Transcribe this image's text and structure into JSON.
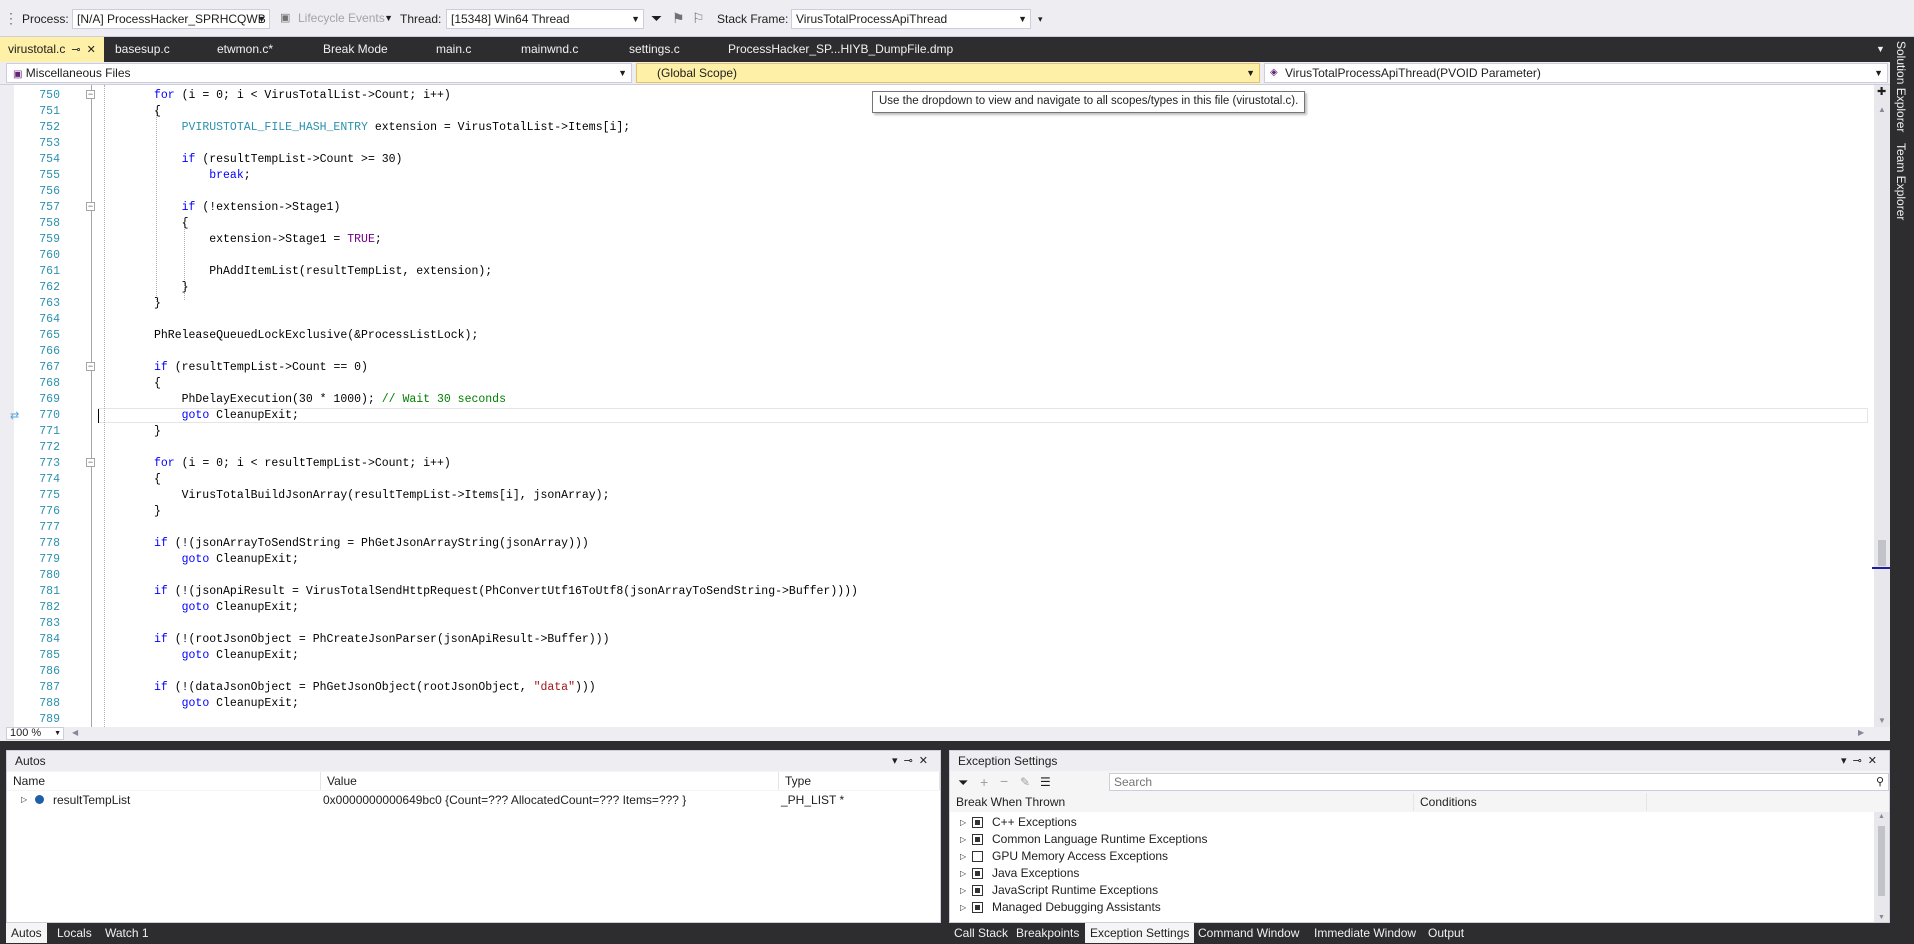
{
  "toolbar": {
    "process_label": "Process:",
    "process_value": "[N/A] ProcessHacker_SPRHCQWB",
    "lifecycle_label": "Lifecycle Events",
    "thread_label": "Thread:",
    "thread_value": "[15348] Win64 Thread",
    "stackframe_label": "Stack Frame:",
    "stackframe_value": "VirusTotalProcessApiThread"
  },
  "tabs": [
    {
      "label": "virustotal.c"
    },
    {
      "label": "basesup.c"
    },
    {
      "label": "etwmon.c*"
    },
    {
      "label": "Break Mode"
    },
    {
      "label": "main.c"
    },
    {
      "label": "mainwnd.c"
    },
    {
      "label": "settings.c"
    },
    {
      "label": "ProcessHacker_SP...HIYB_DumpFile.dmp"
    }
  ],
  "navbar": {
    "project": "Miscellaneous Files",
    "scope": "(Global Scope)",
    "member": "VirusTotalProcessApiThread(PVOID Parameter)"
  },
  "tooltip": "Use the dropdown to view and navigate to all scopes/types in this file (virustotal.c).",
  "editor": {
    "line_numbers": [
      "750",
      "751",
      "752",
      "753",
      "754",
      "755",
      "756",
      "757",
      "758",
      "759",
      "760",
      "761",
      "762",
      "763",
      "764",
      "765",
      "766",
      "767",
      "768",
      "769",
      "770",
      "771",
      "772",
      "773",
      "774",
      "775",
      "776",
      "777",
      "778",
      "779",
      "780",
      "781",
      "782",
      "783",
      "784",
      "785",
      "786",
      "787",
      "788",
      "789"
    ],
    "zoom": "100 %"
  },
  "side_tabs": [
    "Solution Explorer",
    "Team Explorer"
  ],
  "autos": {
    "title": "Autos",
    "columns": [
      "Name",
      "Value",
      "Type"
    ],
    "rows": [
      {
        "name": "resultTempList",
        "value": "0x0000000000649bc0 {Count=??? AllocatedCount=??? Items=??? }",
        "type": "_PH_LIST *"
      }
    ],
    "tabs": [
      "Autos",
      "Locals",
      "Watch 1"
    ]
  },
  "exceptions": {
    "title": "Exception Settings",
    "search_placeholder": "Search",
    "columns": [
      "Break When Thrown",
      "Conditions"
    ],
    "items": [
      {
        "label": "C++ Exceptions",
        "checked": true
      },
      {
        "label": "Common Language Runtime Exceptions",
        "checked": true
      },
      {
        "label": "GPU Memory Access Exceptions",
        "checked": false
      },
      {
        "label": "Java Exceptions",
        "checked": true
      },
      {
        "label": "JavaScript Runtime Exceptions",
        "checked": true
      },
      {
        "label": "Managed Debugging Assistants",
        "checked": true
      }
    ],
    "tabs": [
      "Call Stack",
      "Breakpoints",
      "Exception Settings",
      "Command Window",
      "Immediate Window",
      "Output"
    ]
  },
  "colors": {
    "accent": "#007acc",
    "active_tab": "#fff0a7",
    "keyword": "#0000ff",
    "type": "#2b91af",
    "comment": "#008000",
    "string": "#a31515"
  }
}
